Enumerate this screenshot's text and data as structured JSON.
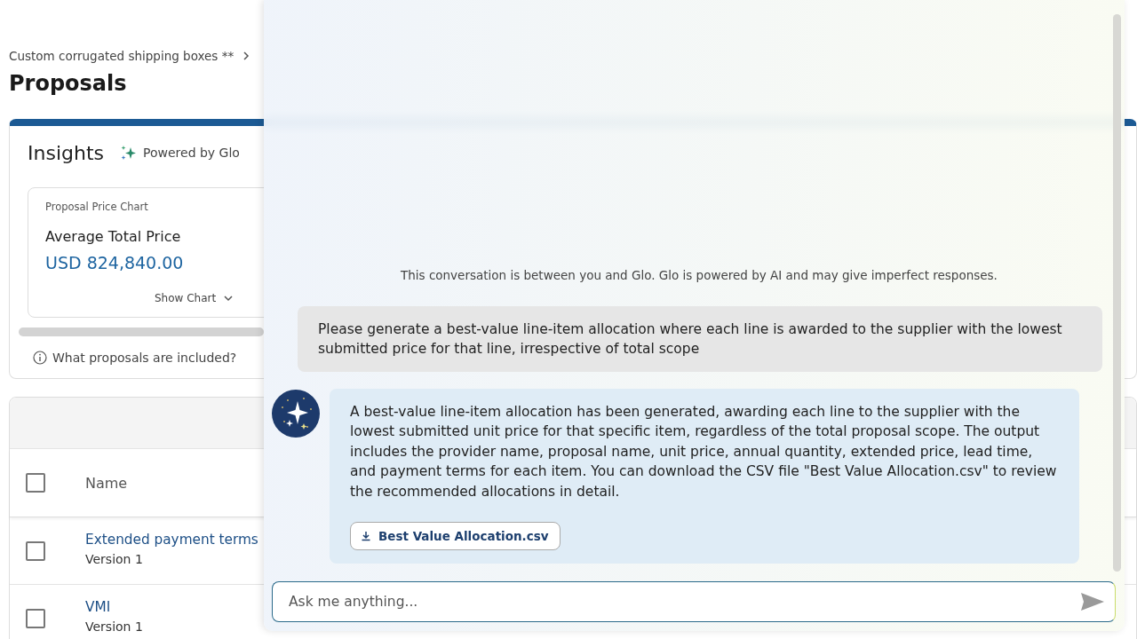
{
  "breadcrumb": {
    "items": [
      "Custom corrugated shipping boxes **"
    ]
  },
  "page_title": "Proposals",
  "insights": {
    "title": "Insights",
    "powered_by": "Powered by Glo",
    "card": {
      "caption": "Proposal Price Chart",
      "metric_label": "Average Total Price",
      "metric_value": "USD 824,840.00",
      "toggle": "Show Chart"
    },
    "info_link": "What proposals are included?"
  },
  "table": {
    "header_checked": false,
    "columns": [
      "Name"
    ],
    "rows": [
      {
        "name": "Extended payment terms",
        "version": "Version 1",
        "checked": false
      },
      {
        "name": "VMI",
        "version": "Version 1",
        "checked": false
      }
    ]
  },
  "chat": {
    "disclaimer": "This conversation is between you and Glo. Glo is powered by AI and may give imperfect responses.",
    "messages": [
      {
        "kind": "user",
        "text": "Please generate a best-value line-item allocation where each line is awarded to the supplier with the lowest submitted price for that line, irrespective of total scope"
      },
      {
        "kind": "assistant",
        "text": "A best-value line-item allocation has been generated, awarding each line to the supplier with the lowest submitted unit price for that specific item, regardless of the total proposal scope. The output includes the provider name, proposal name, unit price, annual quantity, extended price, lead time, and payment terms for each item. You can download the CSV file \"Best Value Allocation.csv\" to review the recommended allocations in detail.",
        "attachment": "Best Value Allocation.csv"
      }
    ],
    "input": {
      "placeholder": "Ask me anything..."
    }
  }
}
